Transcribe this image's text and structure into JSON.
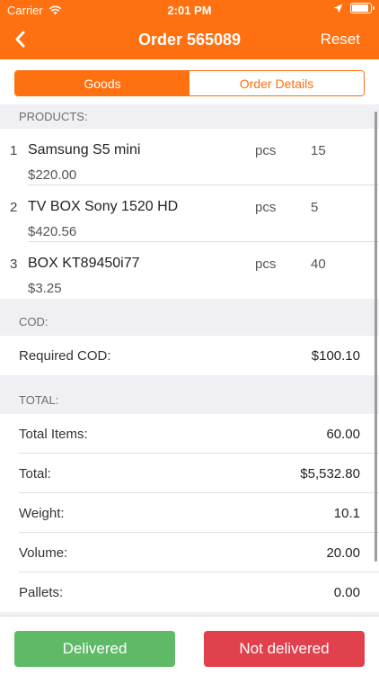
{
  "status_bar": {
    "carrier": "Carrier",
    "time": "2:01 PM"
  },
  "nav": {
    "title": "Order 565089",
    "reset_label": "Reset"
  },
  "tabs": [
    {
      "label": "Goods",
      "active": true
    },
    {
      "label": "Order Details",
      "active": false
    }
  ],
  "products": {
    "header": "PRODUCTS:",
    "items": [
      {
        "index": "1",
        "name": "Samsung S5 mini",
        "unit": "pcs",
        "qty": "15",
        "price": "$220.00"
      },
      {
        "index": "2",
        "name": "TV BOX Sony 1520 HD",
        "unit": "pcs",
        "qty": "5",
        "price": "$420.56"
      },
      {
        "index": "3",
        "name": "BOX KT89450i77",
        "unit": "pcs",
        "qty": "40",
        "price": "$3.25"
      }
    ]
  },
  "cod": {
    "header": "COD:",
    "rows": [
      {
        "label": "Required COD:",
        "value": "$100.10"
      }
    ]
  },
  "total": {
    "header": "TOTAL:",
    "rows": [
      {
        "label": "Total Items:",
        "value": "60.00"
      },
      {
        "label": "Total:",
        "value": "$5,532.80"
      },
      {
        "label": "Weight:",
        "value": "10.1"
      },
      {
        "label": "Volume:",
        "value": "20.00"
      },
      {
        "label": "Pallets:",
        "value": "0.00"
      }
    ]
  },
  "footer": {
    "delivered_label": "Delivered",
    "not_delivered_label": "Not delivered"
  },
  "colors": {
    "accent": "#ff7010",
    "delivered": "#5fba67",
    "not_delivered": "#e0414d"
  },
  "icons": {
    "back": "chevron-left-icon",
    "wifi": "wifi-icon",
    "location": "location-arrow-icon",
    "battery": "battery-icon"
  }
}
